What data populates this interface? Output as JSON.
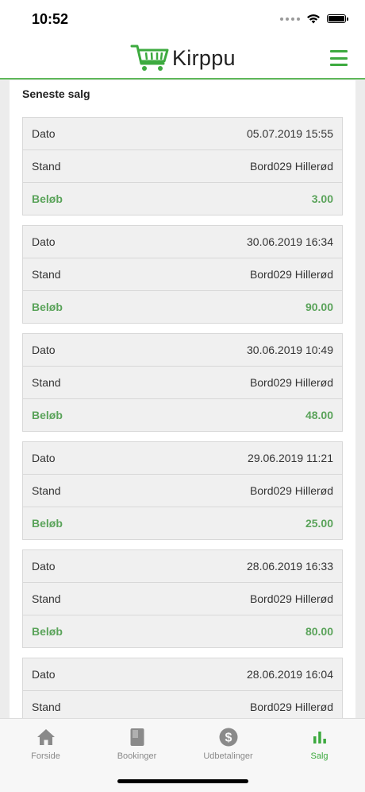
{
  "status": {
    "time": "10:52"
  },
  "header": {
    "logo_text": "Kirppu",
    "accent_color": "#3daa3f"
  },
  "section": {
    "title": "Seneste salg"
  },
  "labels": {
    "date": "Dato",
    "stand": "Stand",
    "amount": "Beløb"
  },
  "sales": [
    {
      "date": "05.07.2019 15:55",
      "stand": "Bord029 Hillerød",
      "amount": "3.00"
    },
    {
      "date": "30.06.2019 16:34",
      "stand": "Bord029 Hillerød",
      "amount": "90.00"
    },
    {
      "date": "30.06.2019 10:49",
      "stand": "Bord029 Hillerød",
      "amount": "48.00"
    },
    {
      "date": "29.06.2019 11:21",
      "stand": "Bord029 Hillerød",
      "amount": "25.00"
    },
    {
      "date": "28.06.2019 16:33",
      "stand": "Bord029 Hillerød",
      "amount": "80.00"
    },
    {
      "date": "28.06.2019 16:04",
      "stand": "Bord029 Hillerød"
    }
  ],
  "tabs": [
    {
      "label": "Forside",
      "icon": "home-icon"
    },
    {
      "label": "Bookinger",
      "icon": "book-icon"
    },
    {
      "label": "Udbetalinger",
      "icon": "dollar-icon"
    },
    {
      "label": "Salg",
      "icon": "bar-chart-icon",
      "active": true
    }
  ]
}
